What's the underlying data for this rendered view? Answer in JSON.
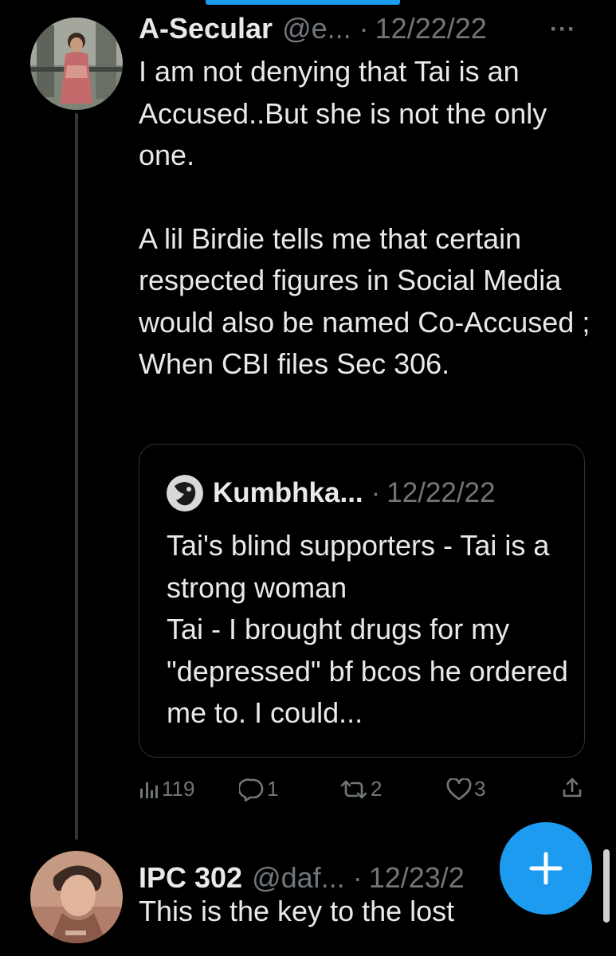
{
  "tweets": [
    {
      "display_name": "A-Secular",
      "handle": "@e...",
      "separator": "·",
      "date": "12/22/22",
      "more_label": "···",
      "paragraphs": [
        "I am not denying that Tai is an Accused..But she is not the only one.",
        "A lil Birdie tells me that certain respected figures in Social Media would also be named Co-Accused ; When CBI files Sec 306."
      ],
      "quote": {
        "display_name": "Kumbhka...",
        "separator": "·",
        "date": "12/22/22",
        "lines": [
          "Tai's blind supporters - Tai is a strong woman",
          "Tai - I brought drugs for my \"depressed\" bf bcos he ordered me to. I could..."
        ]
      },
      "actions": {
        "views": "119",
        "replies": "1",
        "retweets": "2",
        "likes": "3"
      }
    },
    {
      "display_name": "IPC 302",
      "handle": "@daf...",
      "separator": "·",
      "date": "12/23/2",
      "body": "This is the key to the lost"
    }
  ],
  "icons": {
    "views": "analytics-icon",
    "reply": "reply-icon",
    "retweet": "retweet-icon",
    "like": "heart-icon",
    "share": "share-icon",
    "compose": "plus-icon"
  },
  "colors": {
    "background": "#000000",
    "text": "#e7e9ea",
    "muted": "#71767b",
    "accent": "#1d9bf0",
    "border": "#2f3336"
  }
}
